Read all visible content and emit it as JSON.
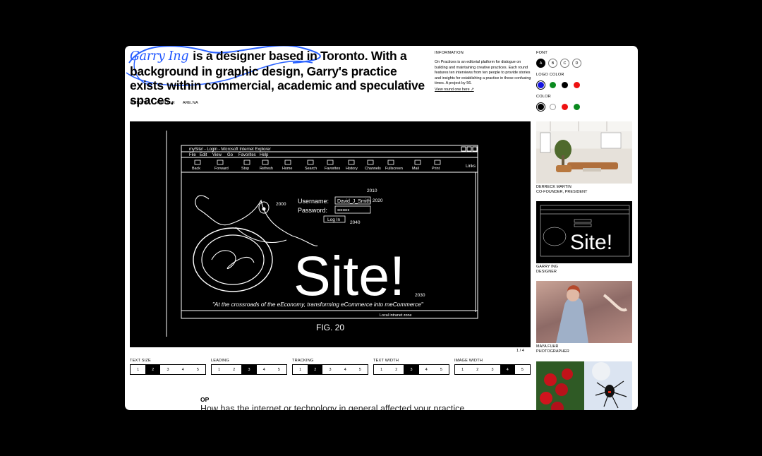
{
  "intro": {
    "name": "Garry Ing",
    "text": "is a designer based in Toronto. With a background in graphic design, Garry's practice exists within commercial, academic and speculative spaces."
  },
  "links": [
    "WEBSITE",
    "TWITTER",
    "ARE.NA"
  ],
  "info": {
    "heading": "INFORMATION",
    "body": "On Practices is an editorial platform for dialogue on building and maintaining creative practices. Each round features ten interviews from ten people to provide stories and insights for establishing a practice in these confusing times. A project by 56.",
    "link": "View round one here ↗"
  },
  "controls": {
    "font": {
      "label": "FONT",
      "options": [
        "A",
        "B",
        "C",
        "D"
      ],
      "selected": "A"
    },
    "logo_color": {
      "label": "LOGO COLOR",
      "colors": [
        "#1414e0",
        "#0a8a1e",
        "#000000",
        "#ee1111"
      ],
      "selected": 0
    },
    "color": {
      "label": "COLOR",
      "colors": [
        "#000000",
        "#ffffff",
        "#ee1111",
        "#0a8a1e"
      ],
      "selected": 0
    }
  },
  "figure": {
    "window_title": "mySite! - Login - Microsoft Internet Explorer",
    "menu": [
      "File",
      "Edit",
      "View",
      "Go",
      "Favorites",
      "Help"
    ],
    "toolbar": [
      "Back",
      "Forward",
      "Stop",
      "Refresh",
      "Home",
      "Search",
      "Favorites",
      "History",
      "Channels",
      "Fullscreen",
      "Mail",
      "Print"
    ],
    "links_label": "Links",
    "username_label": "Username:",
    "username_value": "David_J_Smith",
    "password_label": "Password:",
    "password_value": "•••••••",
    "login_button": "Log In",
    "refs": [
      "2000",
      "2010",
      "2020",
      "2040",
      "2030"
    ],
    "big_text": "Site!",
    "quote": "\"At the crossroads of the eEconomy, transforming eCommerce into meCommerce\"",
    "status": "Local intranet zone",
    "fig_label": "FIG. 20"
  },
  "counter": "1 / 4",
  "sliders": [
    {
      "label": "TEXT SIZE",
      "steps": [
        "1",
        "2",
        "3",
        "4",
        "5"
      ],
      "active": 2
    },
    {
      "label": "LEADING",
      "steps": [
        "1",
        "2",
        "3",
        "4",
        "5"
      ],
      "active": 3
    },
    {
      "label": "TRACKING",
      "steps": [
        "1",
        "2",
        "3",
        "4",
        "5"
      ],
      "active": 2
    },
    {
      "label": "TEXT WIDTH",
      "steps": [
        "1",
        "2",
        "3",
        "4",
        "5"
      ],
      "active": 3
    },
    {
      "label": "IMAGE WIDTH",
      "steps": [
        "1",
        "2",
        "3",
        "4",
        "5"
      ],
      "active": 4
    }
  ],
  "op_label": "OP",
  "question": "How has the internet or technology in general affected your practice",
  "people": [
    {
      "name": "DERRECK MARTIN",
      "role": "CO-FOUNDER, PRESIDENT"
    },
    {
      "name": "GARRY ING",
      "role": "DESIGNER"
    },
    {
      "name": "MAYA FUHR",
      "role": "PHOTOGRAPHER"
    }
  ]
}
